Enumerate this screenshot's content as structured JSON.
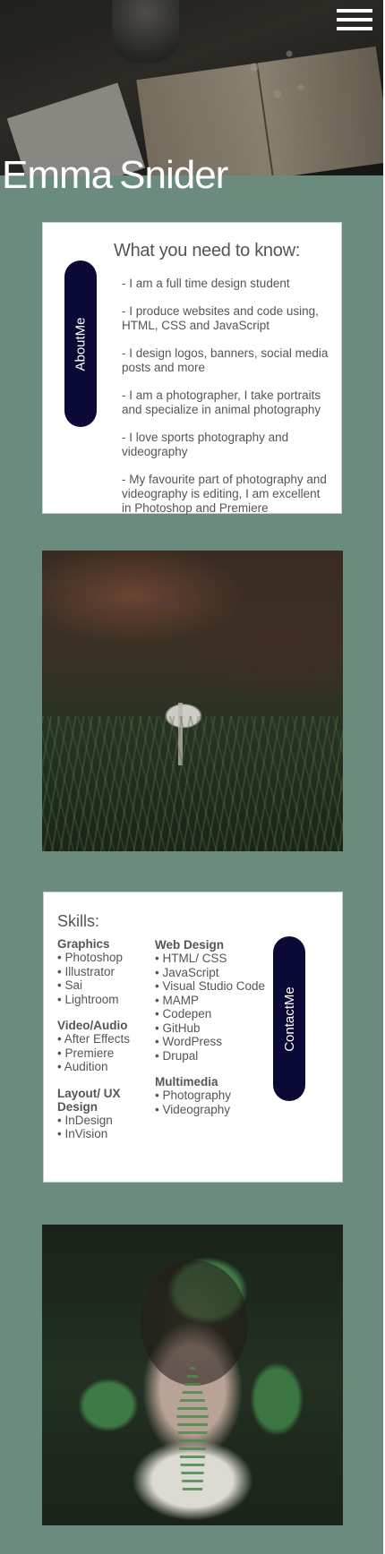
{
  "header": {
    "title_first": "Emma",
    "title_last": "Snider",
    "menu_icon": "hamburger-menu-icon"
  },
  "about": {
    "tab_label": "AboutMe",
    "heading": "What you need to know:",
    "items": [
      "- I am a full time design student",
      "- I produce websites and code using, HTML, CSS and JavaScript",
      "- I design logos, banners, social media posts and more",
      "- I am a photographer, I take portraits and specialize in animal photography",
      "- I  love sports photography and videography",
      "- My favourite part of photography and videography is editing, I am excellent in Photoshop and Premiere"
    ]
  },
  "skills": {
    "heading": "Skills:",
    "contact_label": "ContactMe",
    "groups": [
      {
        "title": "Graphics",
        "items": [
          "• Photoshop",
          "• Illustrator",
          "• Sai",
          "• Lightroom"
        ]
      },
      {
        "title": "Video/Audio",
        "items": [
          "• After Effects",
          "• Premiere",
          "• Audition"
        ]
      },
      {
        "title": " Layout/ UX Design",
        "items": [
          "• InDesign",
          "• InVision"
        ]
      },
      {
        "title": "Web Design",
        "items": [
          "• HTML/ CSS",
          "• JavaScript",
          "• Visual Studio Code",
          "• MAMP",
          "• Codepen",
          "• GitHub",
          "• WordPress",
          "• Drupal"
        ]
      },
      {
        "title": "Multimedia",
        "items": [
          "• Photography",
          "• Videography"
        ]
      }
    ]
  },
  "colors": {
    "page_background": "#6b8b7f",
    "pill": "#0b0a36",
    "card": "#ffffff",
    "text": "#555555"
  }
}
